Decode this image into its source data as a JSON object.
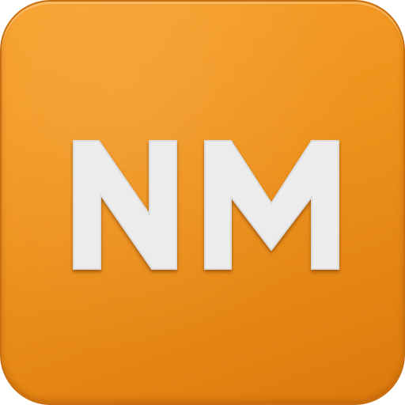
{
  "app_icon": {
    "monogram": "NM",
    "colors": {
      "background_top": "#f8a02a",
      "background_bottom": "#dc7a0c",
      "border": "#c96f0f",
      "letter_fill": "#ececec"
    }
  }
}
